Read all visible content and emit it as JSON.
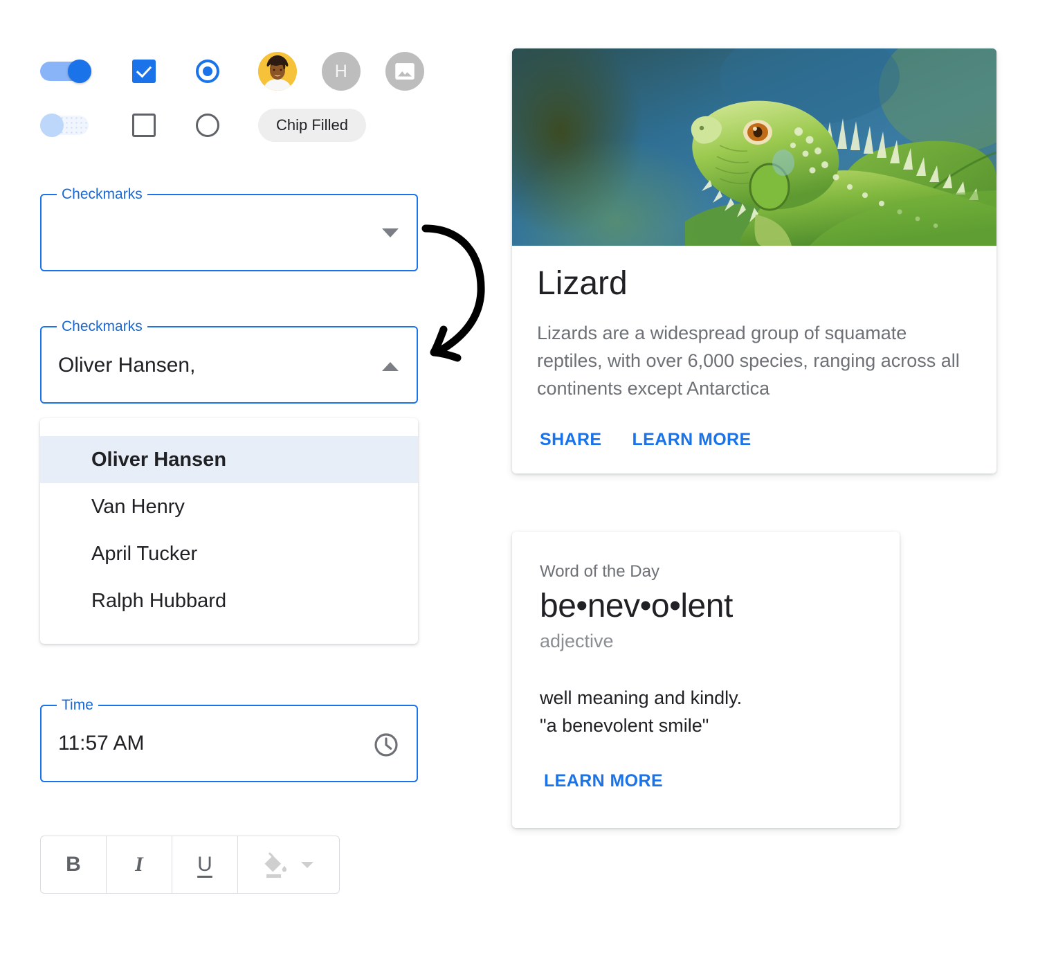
{
  "controls": {
    "toggle_on": {
      "name": "switch-on",
      "state": "on"
    },
    "toggle_off": {
      "name": "switch-off",
      "state": "off"
    },
    "checkbox_checked": {
      "state": "checked"
    },
    "checkbox_unchecked": {
      "state": "unchecked"
    },
    "radio_selected": {
      "state": "selected"
    },
    "radio_unselected": {
      "state": "unselected"
    },
    "avatar_photo_label": "",
    "avatar_letter_label": "H",
    "avatar_image_icon": "image-icon",
    "chip_label": "Chip Filled"
  },
  "select_empty": {
    "label": "Checkmarks",
    "value": "",
    "caret": "chevron-down-icon"
  },
  "select_filled": {
    "label": "Checkmarks",
    "value": "Oliver Hansen,",
    "caret": "chevron-up-icon"
  },
  "dropdown": {
    "items": [
      {
        "label": "Oliver Hansen",
        "selected": true
      },
      {
        "label": "Van Henry",
        "selected": false
      },
      {
        "label": "April Tucker",
        "selected": false
      },
      {
        "label": "Ralph Hubbard",
        "selected": false
      }
    ]
  },
  "time_field": {
    "label": "Time",
    "value": "11:57 AM",
    "icon": "clock-icon"
  },
  "format_toolbar": {
    "bold_label": "B",
    "italic_label": "I",
    "underline_label": "U",
    "fill_color_icon": "format-fill-color-icon",
    "fill_caret_icon": "chevron-down-icon"
  },
  "media_card": {
    "image_alt": "green iguana lizard on a leaf",
    "title": "Lizard",
    "body": "Lizards are a widespread group of squamate reptiles, with over 6,000 species, ranging across all continents except Antarctica",
    "actions": [
      "SHARE",
      "LEARN MORE"
    ]
  },
  "word_card": {
    "eyebrow": "Word of the Day",
    "word": "be•nev•o•lent",
    "part_of_speech": "adjective",
    "definition": "well meaning and kindly.\n\"a benevolent smile\"",
    "action": "LEARN MORE"
  },
  "colors": {
    "primary_blue": "#1a73e8",
    "label_blue": "#1967d2",
    "toggle_track_on": "#8ab4f8",
    "toggle_thumb_off": "#bcd7fa",
    "avatar_gray": "#bdbdbd",
    "avatar_yellow": "#f6c23a",
    "chip_bg": "#eeeeee",
    "menu_selected_bg": "#e8eef8",
    "body_text": "#6d7176",
    "title_text": "#202124",
    "border_gray": "#dadce0"
  }
}
